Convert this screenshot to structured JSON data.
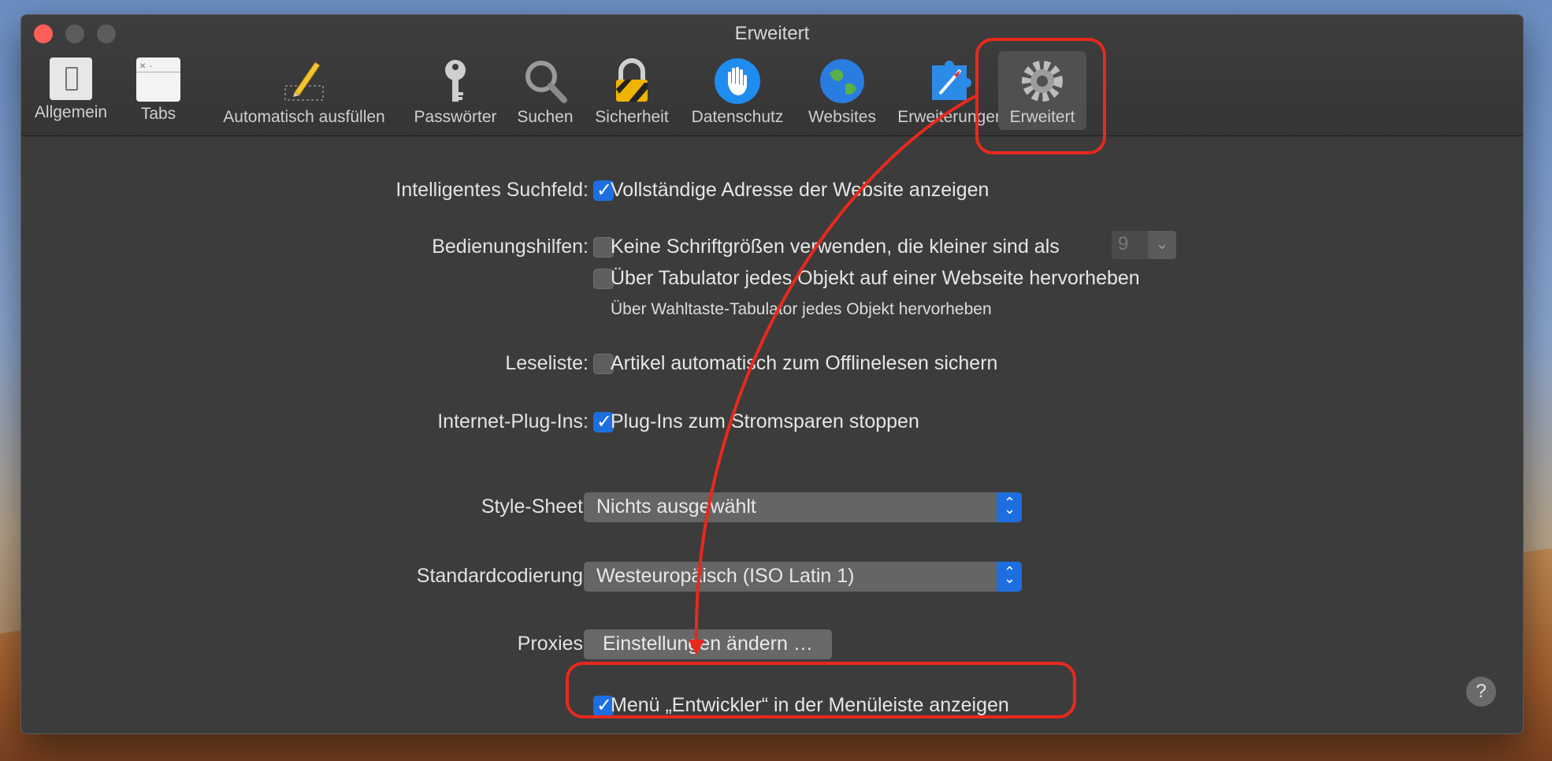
{
  "window": {
    "title": "Erweitert"
  },
  "toolbar": {
    "items": [
      {
        "label": "Allgemein",
        "icon": "general-switch-icon"
      },
      {
        "label": "Tabs",
        "icon": "tabs-icon"
      },
      {
        "label": "Automatisch ausfüllen",
        "icon": "pencil-icon"
      },
      {
        "label": "Passwörter",
        "icon": "key-icon"
      },
      {
        "label": "Suchen",
        "icon": "magnifier-icon"
      },
      {
        "label": "Sicherheit",
        "icon": "lock-icon"
      },
      {
        "label": "Datenschutz",
        "icon": "hand-icon"
      },
      {
        "label": "Websites",
        "icon": "globe-icon"
      },
      {
        "label": "Erweiterungen",
        "icon": "puzzle-icon"
      },
      {
        "label": "Erweitert",
        "icon": "gear-icon"
      }
    ],
    "active": "Erweitert"
  },
  "settings": {
    "smart_search": {
      "label": "Intelligentes Suchfeld:",
      "option": "Vollständige Adresse der Website anzeigen",
      "checked": true
    },
    "accessibility": {
      "label": "Bedienungshilfen:",
      "option1": "Keine Schriftgrößen verwenden, die kleiner sind als",
      "option1_checked": false,
      "min_font_size": "9",
      "option2": "Über Tabulator jedes Objekt auf einer Webseite hervorheben",
      "option2_checked": false,
      "hint": "Über Wahltaste-Tabulator jedes Objekt hervorheben"
    },
    "reading_list": {
      "label": "Leseliste:",
      "option": "Artikel automatisch zum Offlinelesen sichern",
      "checked": false
    },
    "plugins": {
      "label": "Internet-Plug-Ins:",
      "option": "Plug-Ins zum Stromsparen stoppen",
      "checked": true
    },
    "stylesheet": {
      "label": "Style-Sheet:",
      "value": "Nichts ausgewählt"
    },
    "encoding": {
      "label": "Standardcodierung:",
      "value": "Westeuropäisch (ISO Latin 1)"
    },
    "proxies": {
      "label": "Proxies:",
      "button": "Einstellungen ändern …"
    },
    "develop_menu": {
      "option": "Menü „Entwickler“ in der Menüleiste anzeigen",
      "checked": true
    }
  },
  "help": {
    "label": "?"
  },
  "annotation_color": "#e8291e"
}
